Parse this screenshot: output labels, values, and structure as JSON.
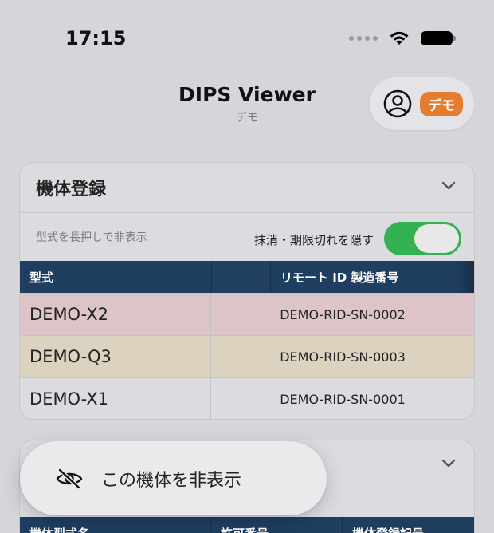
{
  "status": {
    "time": "17:15"
  },
  "header": {
    "title": "DIPS Viewer",
    "subtitle": "デモ",
    "badge": "デモ",
    "icons": [
      "account-circle-icon",
      "wifi-icon",
      "battery-icon",
      "cellular-signal-icon"
    ]
  },
  "aircraft_card": {
    "title": "機体登録",
    "hint": "型式を長押しで非表示",
    "toggle_label": "抹消・期限切れを隠す",
    "toggle_on": true,
    "columns": [
      "型式",
      "",
      "リモート ID 製造番号"
    ],
    "rows": [
      {
        "model": "DEMO-X2",
        "rid": "DEMO-RID-SN-0002",
        "color": "#ddc4c8"
      },
      {
        "model": "DEMO-Q3",
        "rid": "DEMO-RID-SN-0003",
        "color": "#dcd2c0"
      },
      {
        "model": "DEMO-X1",
        "rid": "DEMO-RID-SN-0001",
        "color": "#dcdce0"
      }
    ]
  },
  "second_card": {
    "columns": [
      "機体型式名",
      "許可番号",
      "機体登録記号"
    ]
  },
  "context_menu": {
    "label": "この機体を非表示",
    "icon": "eye-slash-icon"
  },
  "colors": {
    "accent_green": "#34b150",
    "badge_orange": "#e57d2c",
    "table_header": "#1f3e60"
  }
}
